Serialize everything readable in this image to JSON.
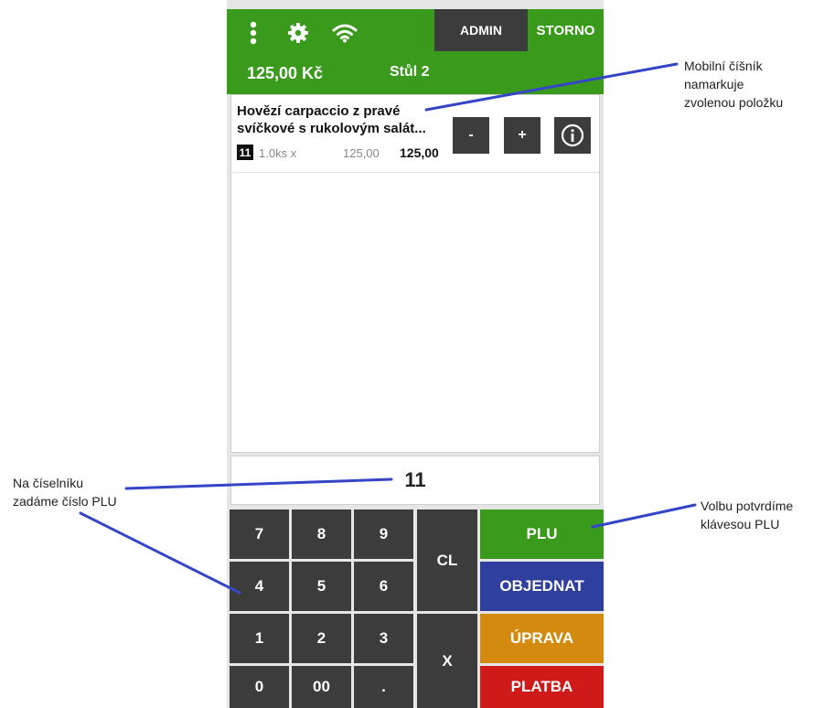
{
  "header": {
    "menu_icon": "vertical-dots-icon",
    "settings_icon": "gear-icon",
    "wifi_icon": "wifi-icon",
    "admin_label": "ADMIN",
    "storno_label": "STORNO",
    "total": "125,00 Kč",
    "table": "Stůl 2"
  },
  "order": {
    "items": [
      {
        "name": "Hovězí carpaccio z pravé svíčkové s rukolovým salát...",
        "plu": "11",
        "qty": "1.0ks x",
        "unit_price": "125,00",
        "line_total": "125,00"
      }
    ],
    "minus_label": "-",
    "plus_label": "+",
    "info_icon": "info-circle-icon"
  },
  "keypad": {
    "display_value": "11",
    "keys": {
      "k7": "7",
      "k8": "8",
      "k9": "9",
      "k4": "4",
      "k5": "5",
      "k6": "6",
      "k1": "1",
      "k2": "2",
      "k3": "3",
      "k0": "0",
      "k00": "00",
      "kdot": ".",
      "cl": "CL",
      "x": "X"
    },
    "actions": {
      "plu": "PLU",
      "objednat": "OBJEDNAT",
      "uprava": "ÚPRAVA",
      "platba": "PLATBA"
    }
  },
  "annotations": {
    "waiter_line1": "Mobilní číšník",
    "waiter_line2": "namarkuje",
    "waiter_line3": "zvolenou položku",
    "keypad_line1": "Na číselníku",
    "keypad_line2": "zadáme číslo PLU",
    "confirm_line1": "Volbu potvrdíme",
    "confirm_line2": "klávesou PLU"
  },
  "colors": {
    "green": "#3a9a1c",
    "blue": "#2f3f9e",
    "orange": "#d38a0e",
    "red": "#cf1a1a",
    "key_dark": "#3c3c3c",
    "annotation_line": "#3545c8"
  }
}
